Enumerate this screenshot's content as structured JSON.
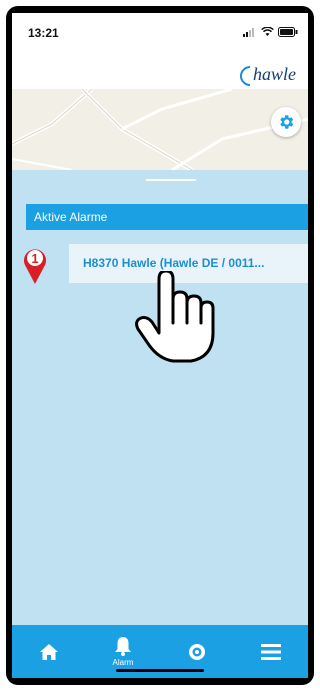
{
  "status_bar": {
    "time": "13:21"
  },
  "header": {
    "logo_text": "hawle"
  },
  "map": {
    "settings_icon": "gear-icon"
  },
  "alarms": {
    "section_title": "Aktive Alarme",
    "items": [
      {
        "badge": "1",
        "label": "H8370 Hawle (Hawle DE / 0011..."
      }
    ]
  },
  "tabbar": {
    "tabs": [
      {
        "icon": "home-icon",
        "label": ""
      },
      {
        "icon": "bell-icon",
        "label": "Alarm"
      },
      {
        "icon": "sensor-icon",
        "label": ""
      },
      {
        "icon": "menu-icon",
        "label": ""
      }
    ]
  },
  "colors": {
    "accent": "#1aa0e3",
    "background": "#bfe1f1",
    "pin": "#d81f26",
    "item_text": "#1a8fd1"
  }
}
